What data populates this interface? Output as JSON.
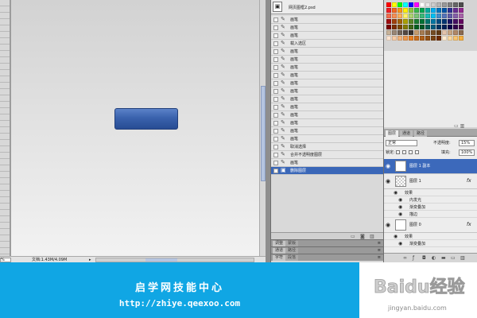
{
  "canvas": {
    "zoom": "%",
    "doc_info": "文档:1.43M/4.09M",
    "doc_info_arrow": "▸",
    "button_color": "#3a62ad"
  },
  "history": {
    "doc_name": "网页图框2.psd",
    "thumb_icon": "document-icon",
    "items": [
      {
        "label": "画笔",
        "icon": "brush-icon"
      },
      {
        "label": "画笔",
        "icon": "brush-icon"
      },
      {
        "label": "画笔",
        "icon": "brush-icon"
      },
      {
        "label": "载入选区",
        "icon": "selection-icon"
      },
      {
        "label": "画笔",
        "icon": "brush-icon"
      },
      {
        "label": "画笔",
        "icon": "brush-icon"
      },
      {
        "label": "画笔",
        "icon": "brush-icon"
      },
      {
        "label": "画笔",
        "icon": "brush-icon"
      },
      {
        "label": "画笔",
        "icon": "brush-icon"
      },
      {
        "label": "画笔",
        "icon": "brush-icon"
      },
      {
        "label": "画笔",
        "icon": "brush-icon"
      },
      {
        "label": "画笔",
        "icon": "brush-icon"
      },
      {
        "label": "画笔",
        "icon": "brush-icon"
      },
      {
        "label": "画笔",
        "icon": "brush-icon"
      },
      {
        "label": "画笔",
        "icon": "brush-icon"
      },
      {
        "label": "画笔",
        "icon": "brush-icon"
      },
      {
        "label": "取消选择",
        "icon": "deselect-icon"
      },
      {
        "label": "合并不透明度图层",
        "icon": "merge-icon"
      },
      {
        "label": "画笔",
        "icon": "brush-icon"
      },
      {
        "label": "删除图层",
        "icon": "delete-layer-icon",
        "selected": true
      }
    ],
    "collapsed_tabs": [
      {
        "tabs": [
          "调整",
          "蒙版"
        ]
      },
      {
        "tabs": [
          "通道",
          "路径"
        ]
      },
      {
        "tabs": [
          "字符",
          "段落"
        ]
      }
    ]
  },
  "swatches": {
    "rows": [
      [
        "#ff0000",
        "#ffff00",
        "#00ff00",
        "#00ffff",
        "#0000ff",
        "#ff00ff",
        "#ffffff",
        "#e6e6e6",
        "#cccccc",
        "#b3b3b3",
        "#999999",
        "#808080",
        "#666666",
        "#4d4d4d"
      ],
      [
        "#ed1c24",
        "#f26522",
        "#f7941d",
        "#fff200",
        "#8dc63f",
        "#39b54a",
        "#00a651",
        "#00a99d",
        "#00aeef",
        "#0072bc",
        "#0054a6",
        "#2e3192",
        "#662d91",
        "#92278f"
      ],
      [
        "#f26c4f",
        "#f68e55",
        "#fbaf5c",
        "#fff467",
        "#acd372",
        "#7cc576",
        "#3bb878",
        "#1abbb4",
        "#00bff3",
        "#438cca",
        "#5574b9",
        "#605ca8",
        "#855fa8",
        "#a763a8"
      ],
      [
        "#9e0b0f",
        "#a0410d",
        "#a36209",
        "#aba000",
        "#598527",
        "#1a7b30",
        "#007236",
        "#00746b",
        "#0076a3",
        "#004b80",
        "#003471",
        "#1b1464",
        "#440e62",
        "#630460"
      ],
      [
        "#790000",
        "#7b2e00",
        "#7d4900",
        "#827b00",
        "#406618",
        "#005e20",
        "#005826",
        "#005952",
        "#005b7f",
        "#003663",
        "#002157",
        "#0d004c",
        "#32004b",
        "#4b0049"
      ],
      [
        "#c7b299",
        "#998675",
        "#736357",
        "#534741",
        "#37302d",
        "#c69c6d",
        "#a67c52",
        "#8c6239",
        "#754c24",
        "#603913",
        "#e3c3ab",
        "#c8a582",
        "#b08766",
        "#8b6a4f"
      ],
      [
        "#fbe3cf",
        "#f5cba7",
        "#f0b27a",
        "#eb984e",
        "#e67e22",
        "#ca6f1e",
        "#af601a",
        "#935116",
        "#784212",
        "#6e2c00",
        "#fdebd0",
        "#fad7a0",
        "#f8c471",
        "#f5b041"
      ]
    ]
  },
  "layers": {
    "tabs": [
      "图层",
      "通道",
      "路径"
    ],
    "blend_mode": "正常",
    "opacity_label": "不透明度:",
    "opacity_value": "15%",
    "lock_label": "锁定:",
    "fill_label": "填充:",
    "fill_value": "100%",
    "fx_label": "fx",
    "items": [
      {
        "kind": "layer",
        "name": "图层 1 副本",
        "thumb": "white",
        "selected": true
      },
      {
        "kind": "layer",
        "name": "图层 1",
        "thumb": "trans",
        "fx": true
      },
      {
        "kind": "effect",
        "name": "效果",
        "sub": false
      },
      {
        "kind": "effect",
        "name": "内发光",
        "sub": true
      },
      {
        "kind": "effect",
        "name": "渐变叠加",
        "sub": true
      },
      {
        "kind": "effect",
        "name": "描边",
        "sub": true
      },
      {
        "kind": "layer",
        "name": "图层 0",
        "thumb": "white",
        "fx": true
      },
      {
        "kind": "effect",
        "name": "效果",
        "sub": false
      },
      {
        "kind": "effect",
        "name": "渐变叠加",
        "sub": true
      }
    ],
    "footer_icons": [
      "link-icon",
      "fx-icon",
      "mask-icon",
      "adjustment-icon",
      "folder-icon",
      "new-layer-icon",
      "trash-icon"
    ]
  },
  "banner": {
    "title": "启学网技能中心",
    "url": "http://zhiye.qeexoo.com",
    "bg_color": "#10a6e4"
  },
  "watermark": {
    "logo_text": "Baidu经验",
    "url": "jingyan.baidu.com"
  }
}
